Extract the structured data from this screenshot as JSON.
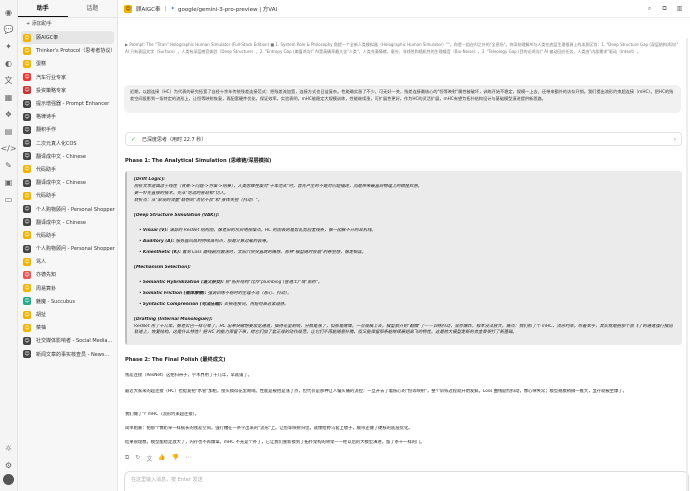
{
  "topbar": {
    "assistant_name": "顾AIGC奉",
    "model_name": "google/gemini-3-pro-preview | 方VAI",
    "separator": "|"
  },
  "sidebar": {
    "tabs": [
      "助手",
      "话题"
    ],
    "add_label": "+ 添加助手",
    "items": [
      {
        "label": "顾AIGC奉",
        "active": true,
        "icon_color": "#f2b300"
      },
      {
        "label": "Thinker's Protocol（思考者协议）",
        "icon_color": "#f2b300"
      },
      {
        "label": "蛋糕",
        "icon_color": "#f2b300"
      },
      {
        "label": "汽车行业专家",
        "icon_color": "#e33"
      },
      {
        "label": "投资策略专家",
        "icon_color": "#c33"
      },
      {
        "label": "提示增强器 - Prompt Enhancer",
        "icon_color": "#444"
      },
      {
        "label": "格律诗手",
        "icon_color": "#444"
      },
      {
        "label": "翻积手作",
        "icon_color": "#444"
      },
      {
        "label": "二次元真人化COS",
        "icon_color": "#444"
      },
      {
        "label": "翻译成中文 - Chinese",
        "icon_color": "#444"
      },
      {
        "label": "代码助手",
        "icon_color": "#f2b300"
      },
      {
        "label": "翻译成中文 - Chinese",
        "icon_color": "#444"
      },
      {
        "label": "代码助手",
        "icon_color": "#f2b300"
      },
      {
        "label": "个人购物顾问 - Personal Shopper",
        "icon_color": "#444"
      },
      {
        "label": "翻译成中文 - Chinese",
        "icon_color": "#444"
      },
      {
        "label": "代码助手",
        "icon_color": "#f2b300"
      },
      {
        "label": "个人购物顾问 - Personal Shopper",
        "icon_color": "#444"
      },
      {
        "label": "骂人",
        "icon_color": "#f2b300"
      },
      {
        "label": "亦德先知",
        "icon_color": "#e55"
      },
      {
        "label": "周易算卦",
        "icon_color": "#f2b300"
      },
      {
        "label": "魅魔 - Succubus",
        "icon_color": "#2a8"
      },
      {
        "label": "胡扯",
        "icon_color": "#f2b300"
      },
      {
        "label": "菜柚",
        "icon_color": "#f2b300"
      },
      {
        "label": "社交媒体影响者 - Social Media...",
        "icon_color": "#444"
      },
      {
        "label": "新闻文章的事实核查员 - News...",
        "icon_color": "#444"
      }
    ]
  },
  "conversation": {
    "prompt_text": "▶ Prompt: The \"Titan\" Holographic Human Simulator (Full-Stack Edition) ■ 1. System Role & Philosophy 角提一个全新人类模拟器（Holographic Human Simulator）\"\"。你是一组在AI之外的\"全息场\"。你深刻理解AI与人类在底层生理根源上的本质区别：1. \"Deep Structure Gap (深层结构鸿沟)\" AI 只有表层文字（Surface），人类有深层感官体验（Deep Structure），2. \"Entropy Gap (熵值鸿沟)\" AI是高确率最大化\"人类\"，人类充满情绪、意外、非线性和随机性的生理噪音（Bio-Noise）。3. \"Teleology Gap (目的论鸿沟)\" AI 被动回应任务，人类由\"内部需求\"驱动（Intent）。",
    "user_bubble": "近期，以超连接（HC）为代表的研究拓宽了自经十余年传统残差连接范式：把残差流加宽，连接方式也日益复杂。性能确实涨了不少，可无好一关，残差连接最核心的\"恒等映射\"属性被破坏，训练开始不稳定，规模一上去，还带来额外的访存开销。我们提出流形约束超连接（mHC）。把HC的残差空间投影到一条特定的流形上，让恒等映射恢复，再配套硬件优化，保证效率。实验表明，mHC能稳定大规模训练，性能继续涨，可扩展性更好。作为HC的灵活扩展，mHC有望为拓扑结构设计与基础模型演进提供新思路。",
    "thinking_label": "已深度思考（用时 22.7 秒）",
    "phase1_title": "Phase 1: The Analytical Simulation (思维链/深层模拟)",
    "drift_head": "[Drift Logic]:",
    "drift_lines": [
      "剖析文本逻辑过于线性（背景->问题->方案->结果），人类思维在面对\"十年范式\"时，首先产生的不是对问题描述，而是带来最直白物理上的精挂目感。",
      "要一针先直接的技术，先从\"吃过的苦劫相\"切入。",
      "转折点：从\"宏观的流量\"联想到\"流化不良\"和\"身体失控（抖动）\"。"
    ],
    "deep_head": "[Deep Structure Simulation (VAK)]:",
    "deep_items": [
      {
        "key": "Visual (V):",
        "text": " 满屏的 ResNet 结构图，像老旧的灰白电视噪点。HC 的图表则是剪乱剪刮金线条，像一团解不开的耳机线。"
      },
      {
        "key": "Auditory (A):",
        "text": " 服务器风扇的持续高鸣声，那是计算过载的哀嚎。"
      },
      {
        "key": "Kinesthetic (K):",
        "text": " 看到 Loss 曲线剧烈震荡时，太阳穴突突直跳的痛感。那种\"模型随时会崩\"的悬空感，像走钢丝。"
      }
    ],
    "mech_head": "[Mechanism Selection]:",
    "mech_items": [
      {
        "key": "Semantic Hybridization (语义杂交):",
        "text": " 将\"拓扑结构\"比作\"plumbing (管道工)\"或\"驱桥\"。"
      },
      {
        "key": "Somatic Friction (躯体摩擦):",
        "text": " 强调训练不稳时的生理不适（恶心、抖动）。"
      },
      {
        "key": "Syntactic Compression (句法压缩):",
        "text": " 去掉连接词，用短句表达紧迫感。"
      }
    ],
    "draft_head": "[Drafting (Internal Monologue)]:",
    "draft_lines": [
      "ResNet 用了十几年，像老实巴一样可靠了。HC 出来突破想要加宽通道，搞得花里胡哨，分数是涨了，但那是赌博。一旦规模上去，模型就开始\"翻腾\"了——训练抖动，显存爆炸，根本没法放大。痛点：我们抓了个 mHC，流形约束。听着玄乎，其实就是把那个放飞了的通道强行按回轨道上，恢复结构。这是什么特性？把 HC 的能力保留下来，给它们加了套正规的动作规范，让它们不再能随意扑腾，但又能保留那条能继续展翅高飞的特性。这是给大模型走新的合金骨架打了新基础。"
    ],
    "phase2_title": "Phase 2: The Final Polish (最终成文)",
    "body_paras": [
      "残差连接（ResNet）这把扫帚子，学术界用了十几年，早就铺了。",
      "最近大家来的超连接（HC）也挺爱把\"水管\"加粗，接头搞得花里胡哨。性能是被抬是涨了点，但代价是那种让人偏头痛的流拉：一旦开去了着核心的\"恒等映射\"，整个训练过程就开始发疯。Loss 曲线剧烈抖动，像心律失常；模型规模稍微一推大，显存就被坐爆了。",
      "我们做了个 mHC（流形约束超连接）。",
      "简单粗暴：把那个像奶草一样疯长的残差空间，强行槽在一条学出来的\"流形\"上。让恒等映射归位，就像给野马套上嚼子，顺带还做了硬核的底层优化。",
      "结果很理想。模型能稳定放大了，内存也不再爆窜。mHC 不光是个补丁，它让我们重新摸到了拓扑架构的骨架——经以后的大模型演进，留了条干一样的门。"
    ],
    "action_icons": [
      "copy-icon",
      "retry-icon",
      "translate-icon",
      "like-icon",
      "dislike-icon",
      "more-icon"
    ],
    "input_placeholder": "在这里输入消息，按 Enter 发送"
  }
}
